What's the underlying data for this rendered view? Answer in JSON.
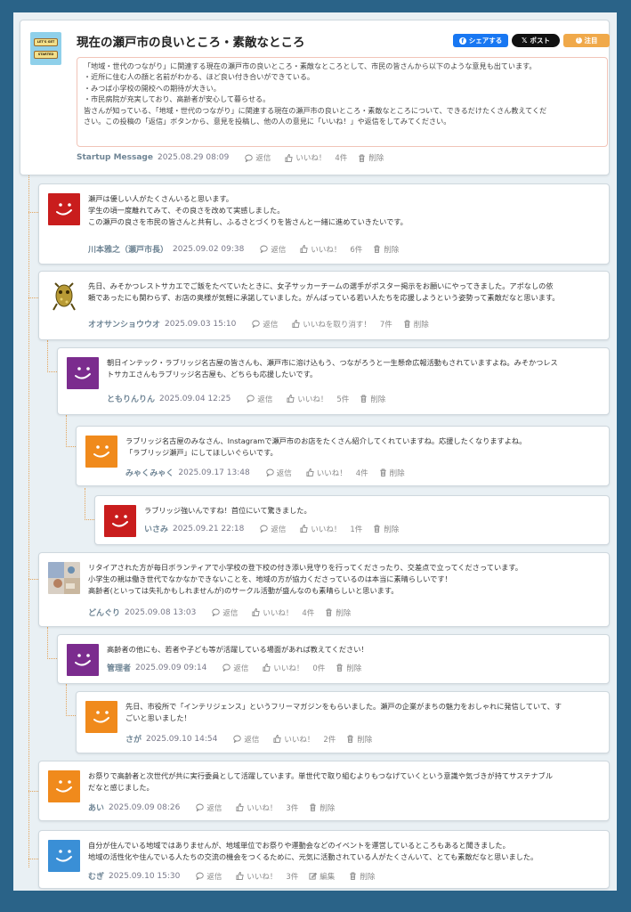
{
  "header": {
    "title": "現在の瀬戸市の良いところ・素敵なところ",
    "logo_text": [
      "LET'S GET",
      "STARTED"
    ],
    "share_facebook": "シェアする",
    "share_x": "ポスト",
    "attention": "注目",
    "intro": "「地域・世代のつながり」に関連する現在の瀬戸市の良いところ・素敵なところとして、市民の皆さんから以下のような意見も出ています。\n・近所に住む人の顔と名前がわかる、ほど良い付き合いができている。\n・みつば小学校の開校への期待が大きい。\n・市民病院が充実しており、高齢者が安心して暮らせる。\n皆さんが知っている、「地域・世代のつながり」に関連する現在の瀬戸市の良いところ・素敵なところについて、できるだけたくさん教えてくだ\nさい。この投稿の「返信」ボタンから、意見を投稿し、他の人の意見に「いいね！」や返信をしてみてください。",
    "author": "Startup Message",
    "date": "2025.08.29 08:09",
    "reply": "返信",
    "like": "いいね！",
    "count": "4件",
    "delete": "削除"
  },
  "comments": [
    {
      "name": "川本雅之（瀬戸市長）",
      "date": "2025.09.02 09:38",
      "text": "瀬戸は優しい人がたくさんいると思います。\n学生の頃一度離れてみて、その良さを改めて実感しました。\nこの瀬戸の良さを市民の皆さんと共有し、ふるさとづくりを皆さんと一緒に進めていきたいです。",
      "like": "いいね！",
      "count": "6件",
      "color": "#c91d1d"
    },
    {
      "name": "オオサンショウウオ",
      "date": "2025.09.03 15:10",
      "text": "先日、みそかつレストサカエでご飯をたべていたときに、女子サッカーチームの選手がポスター掲示をお願いにやってきました。アポなしの依\n頼であったにも関わらず、お店の奥様が気軽に承諾していました。がんばっている若い人たちを応援しようという姿勢って素敵だなと思います。",
      "like": "いいねを取り消す！",
      "count": "7件",
      "color": "#b89a35"
    },
    {
      "name": "ともりんりん",
      "date": "2025.09.04 12:25",
      "text": "朝日インテック・ラブリッジ名古屋の皆さんも、瀬戸市に溶け込もう、つながろうと一生懸命広報活動もされていますよね。みそかつレス\nトサカエさんもラブリッジ名古屋も、どちらも応援したいです。",
      "like": "いいね！",
      "count": "5件",
      "color": "#7b2c8e"
    },
    {
      "name": "みゃくみゃく",
      "date": "2025.09.17 13:48",
      "text": "ラブリッジ名古屋のみなさん、Instagramで瀬戸市のお店をたくさん紹介してくれていますね。応援したくなりますよね。\n「ラブリッジ瀬戸」にしてほしいぐらいです。",
      "like": "いいね！",
      "count": "4件",
      "color": "#f08a1c"
    },
    {
      "name": "いさみ",
      "date": "2025.09.21 22:18",
      "text": "ラブリッジ強いんですね！首位にいて驚きました。",
      "like": "いいね！",
      "count": "1件",
      "color": "#c91d1d"
    },
    {
      "name": "どんぐり",
      "date": "2025.09.08 13:03",
      "text": "リタイアされた方が毎日ボランティアで小学校の登下校の付き添い見守りを行ってくださったり、交差点で立ってくださっています。\n小学生の親は働き世代でなかなかできないことを、地域の方が協力くださっているのは本当に素晴らしいです！\n高齢者(といっては失礼かもしれませんが)のサークル活動が盛んなのも素晴らしいと思います。",
      "like": "いいね！",
      "count": "4件",
      "color": "#8a6f56"
    },
    {
      "name": "管理者",
      "date": "2025.09.09 09:14",
      "text": "高齢者の他にも、若者や子ども等が活躍している場面があれば教えてください！",
      "like": "いいね！",
      "count": "0件",
      "color": "#7b2c8e"
    },
    {
      "name": "さが",
      "date": "2025.09.10 14:54",
      "text": "先日、市役所で「インテリジェンス」というフリーマガジンをもらいました。瀬戸の企業がまちの魅力をおしゃれに発信していて、す\nごいと思いました！",
      "like": "いいね！",
      "count": "2件",
      "color": "#f08a1c"
    },
    {
      "name": "あい",
      "date": "2025.09.09 08:26",
      "text": "お祭りで高齢者と次世代が共に実行委員として活躍しています。単世代で取り組むよりもつなげていくという意識や気づきが持てサステナブル\nだなと感じました。",
      "like": "いいね！",
      "count": "3件",
      "color": "#f08a1c"
    },
    {
      "name": "むぎ",
      "date": "2025.09.10 15:30",
      "text": "自分が住んでいる地域ではありませんが、地域単位でお祭りや運動会などのイベントを運営しているところもあると聞きました。\n地域の活性化や住んでいる人たちの交流の機会をつくるために、元気に活動されている人がたくさんいて、とても素敵だなと思いました。",
      "like": "いいね！",
      "count": "3件",
      "color": "#3a8fd6",
      "edit": "編集"
    }
  ],
  "actions": {
    "reply": "返信",
    "delete": "削除"
  }
}
